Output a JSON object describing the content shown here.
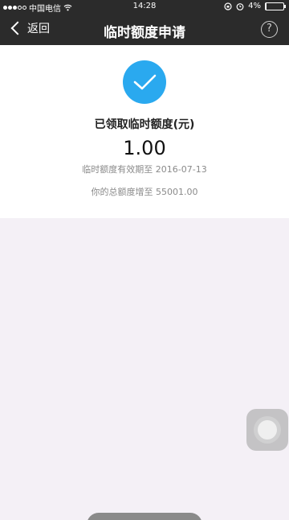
{
  "status_bar": {
    "carrier": "中国电信",
    "time": "14:28",
    "battery": "4%",
    "battery_level": 0.04
  },
  "nav": {
    "back_label": "返回",
    "title": "临时额度申请",
    "help_label": "?"
  },
  "result": {
    "headline": "已领取临时额度(元)",
    "amount": "1.00",
    "expiry_text": "临时额度有效期至 2016-07-13",
    "total_text": "你的总额度增至 55001.00"
  },
  "colors": {
    "nav_bg": "#2b2b2b",
    "accent": "#2aa9ef",
    "page_bg": "#f4f0f6"
  }
}
